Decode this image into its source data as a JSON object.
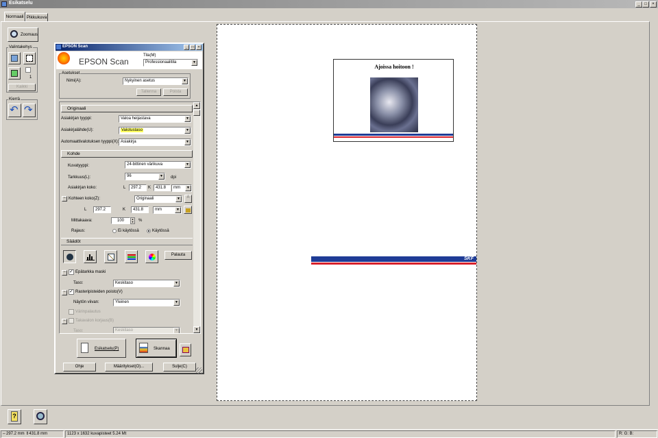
{
  "window": {
    "title": "Esikatselu"
  },
  "tabs": [
    {
      "label": "Normaali"
    },
    {
      "label": "Pikkukuva"
    }
  ],
  "toolbar": {
    "zoom_label": "Zoomaus",
    "frame_group": "Valintakehys",
    "frame_count": "1",
    "delete_label": "Kaikki",
    "rotate_group": "Kierrä"
  },
  "scan": {
    "title": "EPSON Scan",
    "logo": "EPSON Scan",
    "mode_label": "Tila(M)",
    "mode_value": "Professionaalitila",
    "settings_group": "Asetukset",
    "name_label": "Nimi(A):",
    "name_value": "Nykyinen asetus",
    "save_btn": "Tallenna",
    "delete_btn": "Poista",
    "original_header": "Originaali",
    "doc_type_label": "Asiakirjan tyyppi:",
    "doc_type_value": "Valoa heijastava",
    "source_label": "Asiakirjalähde(U):",
    "source_value": "Valotustaso",
    "auto_label": "Automaattivalotuksen tyyppi(X):",
    "auto_value": "Asiakirja",
    "target_header": "Kohde",
    "image_type_label": "Kuvatyyppi:",
    "image_type_value": "24-bittinen värikuva",
    "res_label": "Tarkkuus(L):",
    "res_value": "96",
    "res_unit": "dpi",
    "doc_size_label": "Asiakirjan koko:",
    "w_label": "L",
    "w_value": "297.2",
    "h_label": "K",
    "h_value": "431.8",
    "unit": "mm",
    "target_size_label": "Kohteen koko(Z):",
    "target_size_value": "Originaali",
    "tw_value": "297.2",
    "th_value": "431.8",
    "scale_label": "Mittakaava:",
    "scale_value": "100",
    "scale_unit": "%",
    "trim_label": "Rajaus:",
    "trim_off": "Ei käytössä",
    "trim_on": "Käytössä",
    "adjust_header": "Säädöt",
    "reset_btn": "Palauta",
    "unsharp_label": "Epätarkka maski",
    "level_label": "Taso:",
    "level_value": "Keskitaso",
    "descreen_label": "Rasteripisteiden poisto(V)",
    "display_label": "Näytön viivan:",
    "display_value": "Yleinen",
    "color_restore_label": "Värinpalautus",
    "backlight_label": "Takavalon korjaus(B)",
    "backlight_level_label": "Taso:",
    "backlight_level_value": "Keskitaso",
    "preview_btn": "Esikatselu(P)",
    "scan_btn": "Skannaa",
    "help_btn": "Ohje",
    "config_btn": "Määritykset(O)...",
    "close_btn": "Sulje(C)"
  },
  "preview": {
    "doc_title": "Ajoissa hoitoon !",
    "brand": "SKF"
  },
  "status": {
    "size": "297.2 mm",
    "size2": "431.8 mm",
    "pixels": "1123 x 1632 kuvapisteet 5.24 Mt",
    "rgb": "R: G: B:"
  },
  "colors": {
    "title_active": "#0a246a",
    "title_inactive": "#808080",
    "highlight": "#ffff60",
    "skf_blue": "#1f3c96",
    "skf_red": "#d8202a"
  }
}
